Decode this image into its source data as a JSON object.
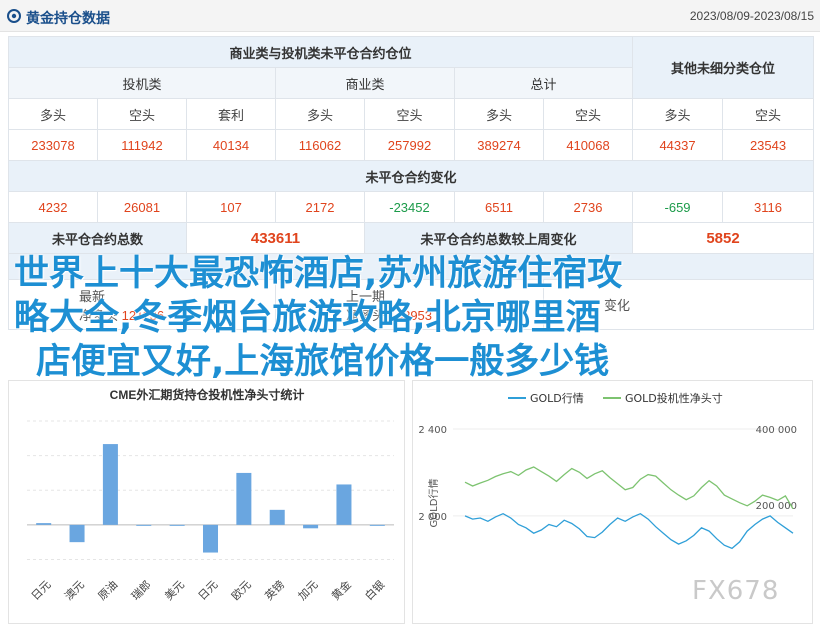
{
  "header": {
    "title": "黄金持仓数据",
    "date_range": "2023/08/09-2023/08/15",
    "accent": "#1a4f8b"
  },
  "positions": {
    "group_title": "商业类与投机类未平仓合约仓位",
    "other_title": "其他未细分类仓位",
    "groups": [
      "投机类",
      "商业类",
      "总计"
    ],
    "columns": [
      "多头",
      "空头",
      "套利",
      "多头",
      "空头",
      "多头",
      "空头",
      "多头",
      "空头"
    ],
    "values": [
      "233078",
      "111942",
      "40134",
      "116062",
      "257992",
      "389274",
      "410068",
      "44337",
      "23543"
    ],
    "change_title": "未平仓合约变化",
    "changes": [
      "4232",
      "26081",
      "107",
      "2172",
      "-23452",
      "6511",
      "2736",
      "-659",
      "3116"
    ],
    "oi_total_label": "未平仓合约总数",
    "oi_total": "433611",
    "oi_change_label": "未平仓合约总数较上周变化",
    "oi_change": "5852",
    "partial_labels": [
      "最新",
      "上一期",
      "变化"
    ],
    "partial_prefix": "净多头",
    "partial_values": [
      "121136",
      "142953",
      ""
    ]
  },
  "overlay_lines": [
    "世界上十大最恐怖酒店,苏州旅游住宿攻",
    "略大全,冬季烟台旅游攻略,北京哪里酒",
    "店便宜又好,上海旅馆价格一般多少钱"
  ],
  "watermark": "FX678",
  "chart_data": [
    {
      "type": "bar",
      "title": "CME外汇期货持仓投机性净头寸统计",
      "categories": [
        "日元",
        "澳元",
        "原油",
        "瑞郎",
        "美元",
        "日元",
        "欧元",
        "英镑",
        "加元",
        "黄金",
        "白银"
      ],
      "values": [
        1.5,
        -15,
        70,
        0,
        -0.5,
        -24,
        45,
        13,
        -3,
        35,
        0
      ],
      "ylim": [
        -40,
        90
      ],
      "color": "#6aa6e0"
    },
    {
      "type": "line",
      "legend": [
        "GOLD行情",
        "GOLD投机性净头寸"
      ],
      "ylabel_left": "GOLD行情",
      "ylabel_right": "",
      "left_ticks": [
        "2 400",
        "2 000"
      ],
      "right_ticks": [
        "400 000",
        "200 000"
      ],
      "left_ylim": [
        1700,
        2400
      ],
      "right_ylim": [
        0,
        400000
      ],
      "series": [
        {
          "name": "GOLD行情",
          "color": "#2f9fd8",
          "values": [
            2000,
            1985,
            1990,
            1975,
            1995,
            2010,
            1990,
            1960,
            1945,
            1920,
            1935,
            1960,
            1950,
            1980,
            1965,
            1940,
            1905,
            1900,
            1925,
            1960,
            1990,
            1975,
            1995,
            2010,
            1985,
            1950,
            1920,
            1890,
            1870,
            1885,
            1910,
            1945,
            1930,
            1895,
            1865,
            1850,
            1880,
            1930,
            1960,
            1985,
            2000,
            1970,
            1945,
            1920
          ]
        },
        {
          "name": "GOLD投机性净头寸",
          "color": "#7dc370",
          "values": [
            260000,
            250000,
            258000,
            265000,
            275000,
            282000,
            288000,
            278000,
            292000,
            300000,
            288000,
            276000,
            262000,
            280000,
            296000,
            286000,
            270000,
            282000,
            290000,
            272000,
            256000,
            240000,
            246000,
            268000,
            280000,
            276000,
            258000,
            240000,
            226000,
            214000,
            224000,
            246000,
            264000,
            250000,
            226000,
            216000,
            206000,
            198000,
            210000,
            226000,
            220000,
            212000,
            224000,
            190000
          ]
        }
      ]
    }
  ]
}
